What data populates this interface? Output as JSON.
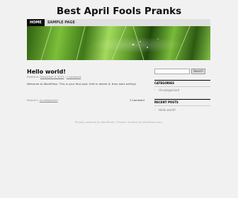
{
  "site": {
    "title": "Best April Fools Pranks"
  },
  "nav": {
    "items": [
      "HOME",
      "SAMPLE PAGE"
    ]
  },
  "post": {
    "title": "Hello world!",
    "meta_prefix": "Posted on",
    "date": "December 4, 2013",
    "meta_sep": "|",
    "comments_link": "1 comment",
    "body": "Welcome to WordPress. This is your first post. Edit or delete it, then start writing!",
    "footer_prefix": "Posted in",
    "category": "Uncategorized",
    "comment_count": "1 Comment"
  },
  "sidebar": {
    "search": {
      "placeholder": "",
      "button": "Search"
    },
    "categories": {
      "title": "CATEGORIES",
      "items": [
        "Uncategorized"
      ]
    },
    "recent_posts": {
      "title": "RECENT POSTS",
      "items": [
        "Hello world!"
      ]
    }
  },
  "footer": {
    "text": "Proudly powered by WordPress  |  Theme: Coraline by WordPress.com."
  }
}
